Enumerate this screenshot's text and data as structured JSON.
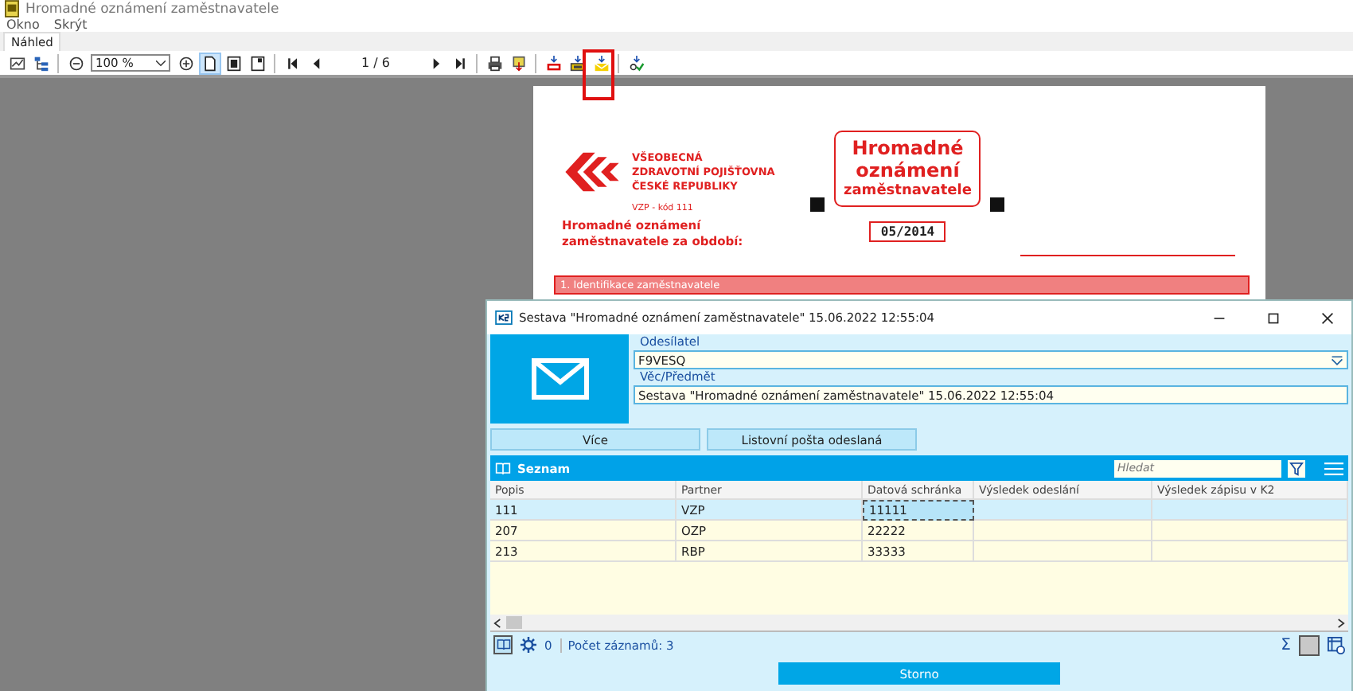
{
  "window": {
    "title": "Hromadné oznámení zaměstnavatele"
  },
  "menu": [
    "Okno",
    "Skrýt"
  ],
  "tabs": [
    {
      "label": "Náhled",
      "selected": true
    }
  ],
  "toolbar": [
    {
      "kind": "chart",
      "pressed": false,
      "highlighted": false
    },
    {
      "kind": "tree",
      "pressed": false,
      "highlighted": false
    },
    {
      "kind": "sep"
    },
    {
      "kind": "zoom-out",
      "pressed": false,
      "highlighted": false
    },
    {
      "kind": "zoom-select",
      "value": "100 %"
    },
    {
      "kind": "zoom-in",
      "pressed": false,
      "highlighted": false
    },
    {
      "kind": "page-one",
      "pressed": true,
      "highlighted": false
    },
    {
      "kind": "page-two",
      "pressed": false,
      "highlighted": false
    },
    {
      "kind": "page-wide",
      "pressed": false,
      "highlighted": false
    },
    {
      "kind": "sep"
    },
    {
      "kind": "first",
      "pressed": false,
      "highlighted": false
    },
    {
      "kind": "prev",
      "pressed": false,
      "highlighted": false
    },
    {
      "kind": "page-counter",
      "value": "1 / 6"
    },
    {
      "kind": "next",
      "pressed": false,
      "highlighted": false
    },
    {
      "kind": "last",
      "pressed": false,
      "highlighted": false
    },
    {
      "kind": "sep"
    },
    {
      "kind": "printer",
      "pressed": false,
      "highlighted": false
    },
    {
      "kind": "export",
      "pressed": false,
      "highlighted": false
    },
    {
      "kind": "sep"
    },
    {
      "kind": "pdf",
      "pressed": false,
      "highlighted": false
    },
    {
      "kind": "save",
      "pressed": false,
      "highlighted": false
    },
    {
      "kind": "mail",
      "pressed": false,
      "highlighted": true
    },
    {
      "kind": "sep"
    },
    {
      "kind": "check",
      "pressed": false,
      "highlighted": false
    }
  ],
  "document": {
    "org_lines": [
      "VŠEOBECNÁ",
      "ZDRAVOTNÍ POJIŠŤOVNA",
      "ČESKÉ REPUBLIKY"
    ],
    "org_code": "VZP - kód 111",
    "title_lines": [
      "Hromadné",
      "oznámení",
      "zaměstnavatele"
    ],
    "heading_lines": [
      "Hromadné oznámení",
      "zaměstnavatele za období:"
    ],
    "period": "05/2014",
    "section": "1. Identifikace zaměstnavatele"
  },
  "dialog": {
    "title": "Sestava \"Hromadné oznámení zaměstnavatele\" 15.06.2022 12:55:04",
    "sender": {
      "label": "Odesílatel",
      "value": "F9VESQ"
    },
    "subject": {
      "label": "Věc/Předmět",
      "value": "Sestava \"Hromadné oznámení zaměstnavatele\" 15.06.2022 12:55:04"
    },
    "buttons": [
      "Více",
      "Listovní pošta odeslaná"
    ],
    "list": {
      "title": "Seznam",
      "search": {
        "placeholder": "Hledat"
      },
      "columns": [
        "Popis",
        "Partner",
        "Datová schránka",
        "Výsledek odeslání",
        "Výsledek zápisu v K2"
      ],
      "rows": [
        {
          "cells": [
            "111",
            "VZP",
            "11111",
            "",
            ""
          ],
          "selected": true
        },
        {
          "cells": [
            "207",
            "OZP",
            "22222",
            "",
            ""
          ],
          "selected": false
        },
        {
          "cells": [
            "213",
            "RBP",
            "33333",
            "",
            ""
          ],
          "selected": false
        }
      ]
    },
    "status": {
      "count": "0",
      "records": "Počet záznamů: 3",
      "sum": "Σ"
    },
    "cancel": "Storno"
  }
}
